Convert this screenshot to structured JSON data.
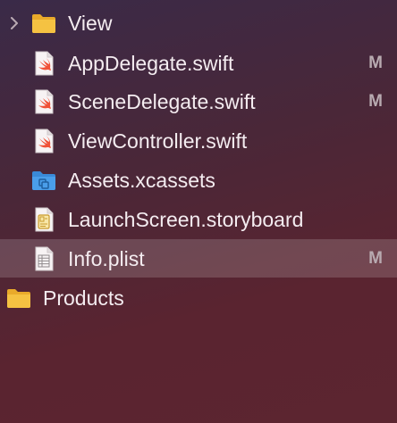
{
  "navigator": {
    "rows": [
      {
        "label": "View",
        "kind": "group-folder",
        "icon": "folder-icon",
        "collapsed": true
      },
      {
        "label": "AppDelegate.swift",
        "kind": "swift-file",
        "icon": "swift-file-icon",
        "status": "M"
      },
      {
        "label": "SceneDelegate.swift",
        "kind": "swift-file",
        "icon": "swift-file-icon",
        "status": "M"
      },
      {
        "label": "ViewController.swift",
        "kind": "swift-file",
        "icon": "swift-file-icon"
      },
      {
        "label": "Assets.xcassets",
        "kind": "asset-catalog",
        "icon": "asset-catalog-icon"
      },
      {
        "label": "LaunchScreen.storyboard",
        "kind": "storyboard",
        "icon": "storyboard-icon"
      },
      {
        "label": "Info.plist",
        "kind": "plist",
        "icon": "plist-file-icon",
        "status": "M",
        "selected": true
      },
      {
        "label": "Products",
        "kind": "group-folder",
        "icon": "folder-icon"
      }
    ]
  },
  "colors": {
    "folder": "#f5c242",
    "swift": "#f05138",
    "asset": "#4a9eea",
    "badge": "#b8aab0"
  }
}
